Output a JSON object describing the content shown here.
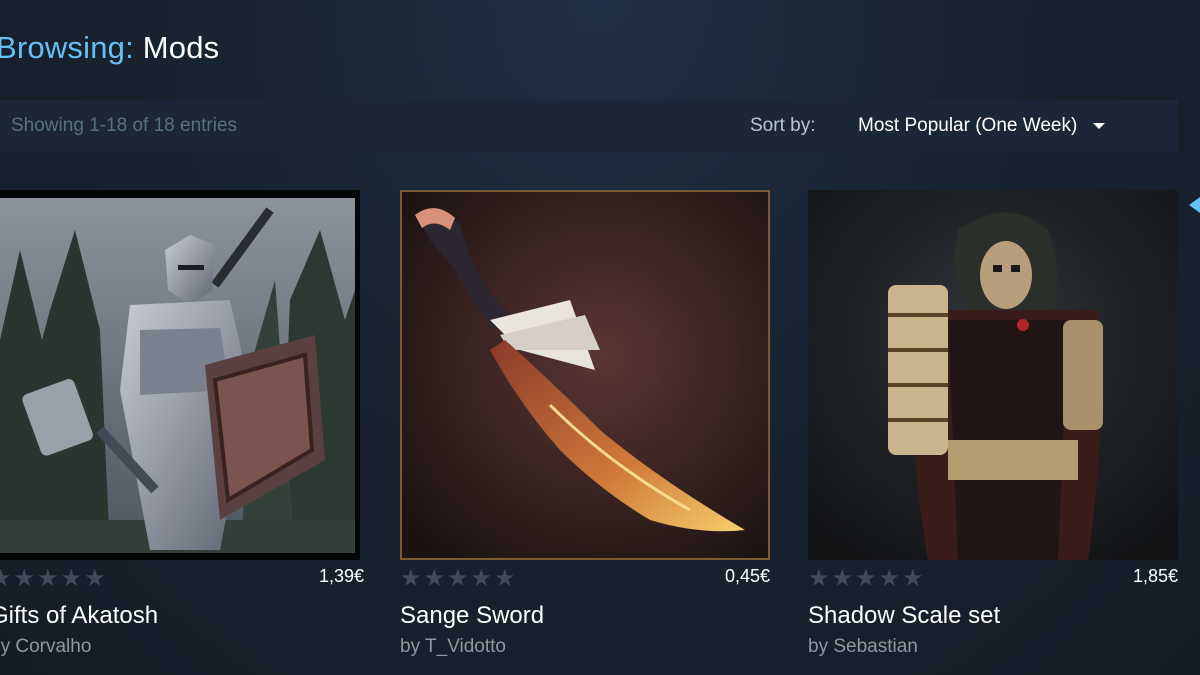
{
  "header": {
    "prefix": "Browsing:",
    "section": "Mods"
  },
  "filter": {
    "entries_text": "Showing 1-18 of 18 entries",
    "sort_label": "Sort by:",
    "sort_value": "Most Popular (One Week)"
  },
  "items": [
    {
      "title": "Gifts of Akatosh",
      "author_prefix": "by",
      "author": "Corvalho",
      "price": "1,39€",
      "rating": "★★★★★",
      "image": "armored-knight-artwork"
    },
    {
      "title": "Sange Sword",
      "author_prefix": "by",
      "author": "T_Vidotto",
      "price": "0,45€",
      "rating": "★★★★★",
      "image": "curved-sword-artwork"
    },
    {
      "title": "Shadow Scale set",
      "author_prefix": "by",
      "author": "Sebastian",
      "price": "1,85€",
      "rating": "★★★★★",
      "image": "hooded-assassin-artwork"
    }
  ],
  "colors": {
    "accent": "#66c0f4",
    "bar": "#1b2738",
    "star_empty": "#3f4b5a"
  }
}
